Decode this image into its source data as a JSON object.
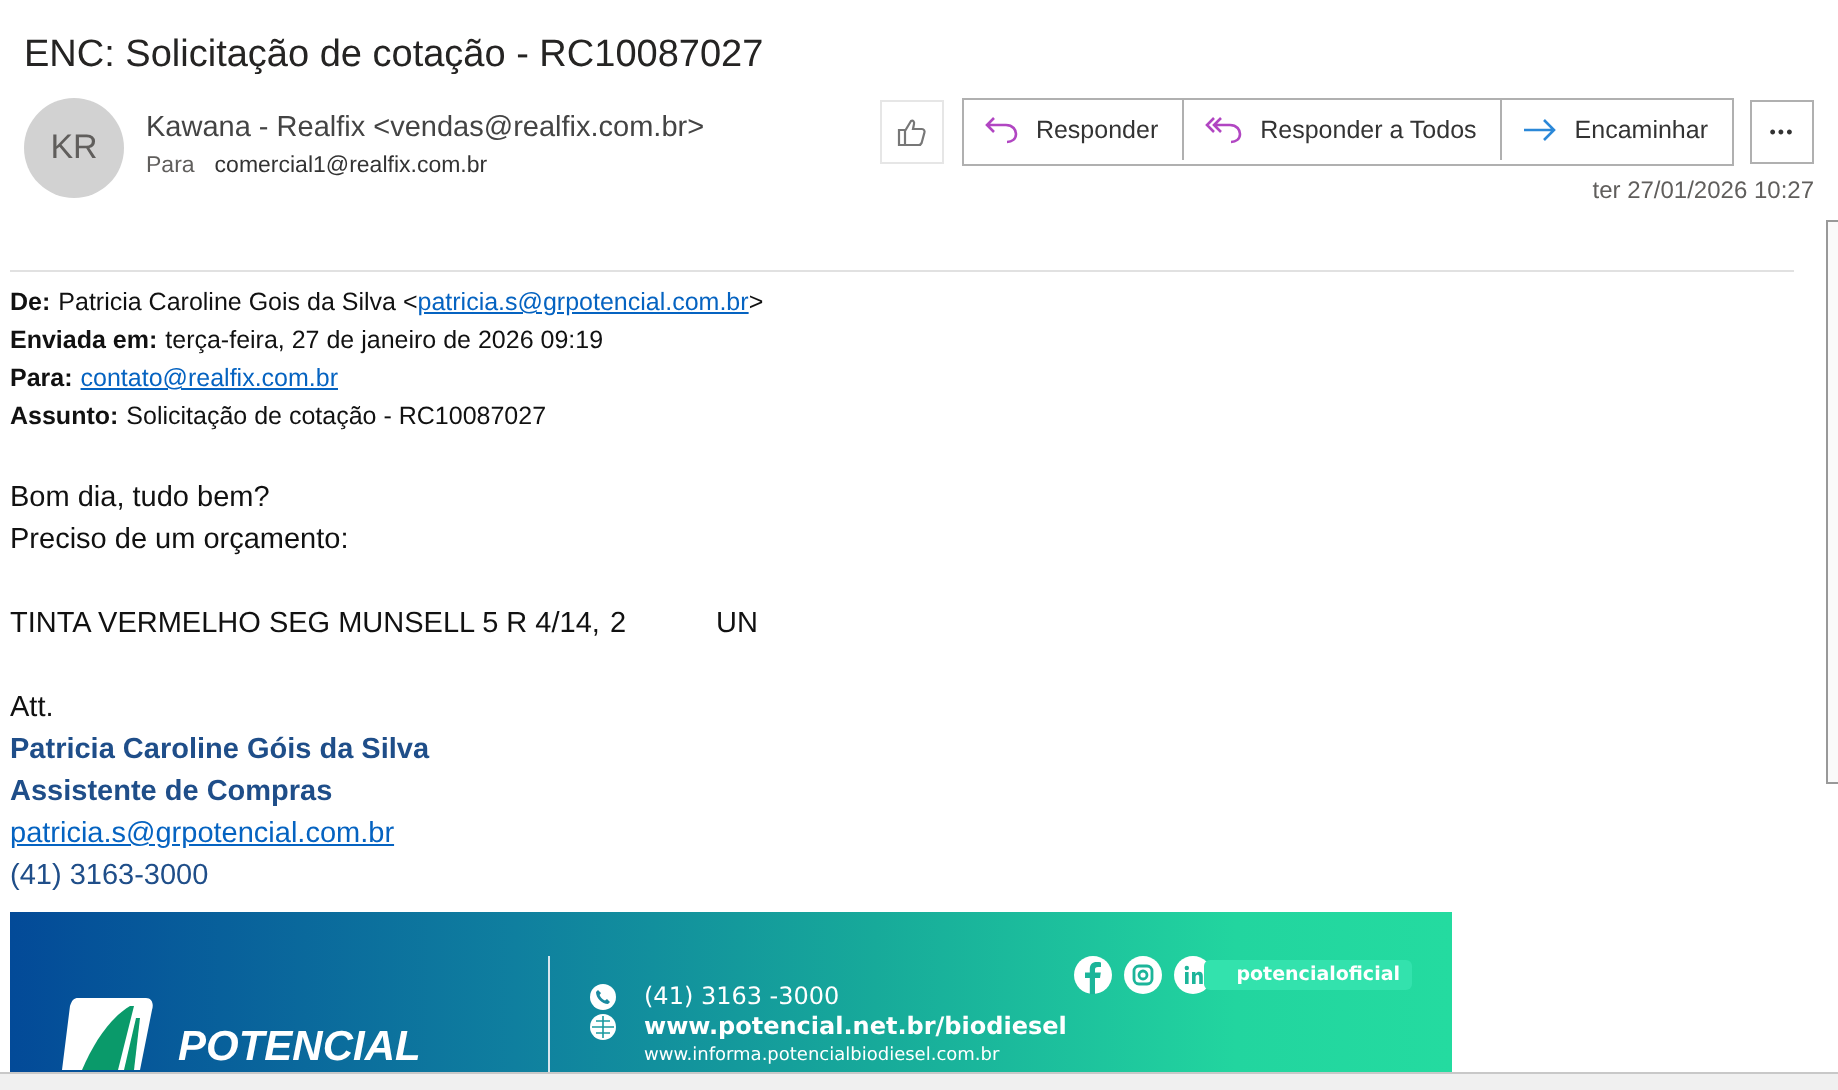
{
  "subject": "ENC: Solicitação de cotação - RC10087027",
  "sender": {
    "initials": "KR",
    "name": "Kawana - Realfix <vendas@realfix.com.br>",
    "to_label": "Para",
    "to": "comercial1@realfix.com.br",
    "date": "ter 27/01/2026 10:27"
  },
  "actions": [
    {
      "kind": "reply",
      "label": "Responder"
    },
    {
      "kind": "reply_all",
      "label": "Responder a Todos"
    },
    {
      "kind": "forward",
      "label": "Encaminhar"
    }
  ],
  "more_label": "•••",
  "forwarded_header": [
    {
      "label": "De:",
      "prefix": "Patricia Caroline Gois da Silva <",
      "link": "patricia.s@grpotencial.com.br",
      "suffix": ">"
    },
    {
      "label": "Enviada em:",
      "prefix": "terça-feira, 27 de janeiro de 2026 09:19"
    },
    {
      "label": "Para:",
      "link": "contato@realfix.com.br"
    },
    {
      "label": "Assunto:",
      "prefix": "Solicitação de cotação - RC10087027"
    }
  ],
  "greeting": [
    "Bom dia, tudo bem?",
    "Preciso de um orçamento:"
  ],
  "item": {
    "description": "TINTA VERMELHO SEG MUNSELL 5 R 4/14,",
    "quantity": "2",
    "unit": "UN"
  },
  "signature": {
    "closing": "Att.",
    "name": "Patricia Caroline Góis da Silva",
    "role": "Assistente de Compras",
    "email": "patricia.s@grpotencial.com.br",
    "phone": "(41) 3163-3000"
  },
  "banner": {
    "brand": "POTENCIAL",
    "phone": "(41) 3163 -3000",
    "site": "www.potencial.net.br/biodiesel",
    "site2": "www.informa.potencialbiodiesel.com.br",
    "handle": "potencialoficial"
  }
}
